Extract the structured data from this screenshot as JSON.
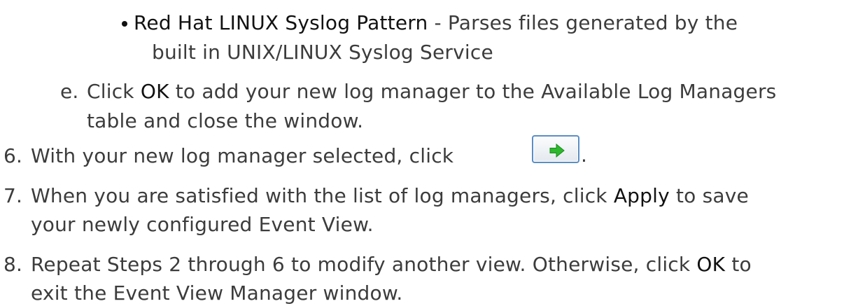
{
  "bullet": {
    "title": "Red Hat LINUX Syslog Pattern",
    "desc_line1": " - Parses files generated by the",
    "desc_line2": "built in UNIX/LINUX Syslog Service"
  },
  "step_e": {
    "marker": "e.",
    "pre": "Click ",
    "ok": "OK",
    "post": " to add your new log manager to the Available Log Managers",
    "line2": "table and close the window."
  },
  "step6": {
    "marker": "6.",
    "text": "With your new log manager selected, click",
    "period": ".",
    "button_icon": "green-right-arrow-icon",
    "arrow_color": "#2db82d"
  },
  "step7": {
    "marker": "7.",
    "pre": "When you are satisfied with the list of log managers, click ",
    "apply": "Apply",
    "post": " to save",
    "line2": "your newly configured Event View."
  },
  "step8": {
    "marker": "8.",
    "pre": "Repeat Steps 2 through 6 to modify another view. Otherwise, click ",
    "ok": "OK",
    "post": " to",
    "line2": "exit the Event View Manager window."
  }
}
